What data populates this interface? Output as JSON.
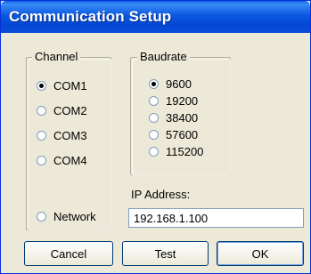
{
  "window": {
    "title": "Communication Setup"
  },
  "channel": {
    "legend": "Channel",
    "options": [
      {
        "label": "COM1",
        "selected": true
      },
      {
        "label": "COM2",
        "selected": false
      },
      {
        "label": "COM3",
        "selected": false
      },
      {
        "label": "COM4",
        "selected": false
      },
      {
        "label": "Network",
        "selected": false
      }
    ]
  },
  "baudrate": {
    "legend": "Baudrate",
    "options": [
      {
        "label": "9600",
        "selected": true
      },
      {
        "label": "19200",
        "selected": false
      },
      {
        "label": "38400",
        "selected": false
      },
      {
        "label": "57600",
        "selected": false
      },
      {
        "label": "115200",
        "selected": false
      }
    ]
  },
  "ip": {
    "label": "IP Address:",
    "value": "192.168.1.100"
  },
  "buttons": {
    "cancel": "Cancel",
    "test": "Test",
    "ok": "OK"
  }
}
